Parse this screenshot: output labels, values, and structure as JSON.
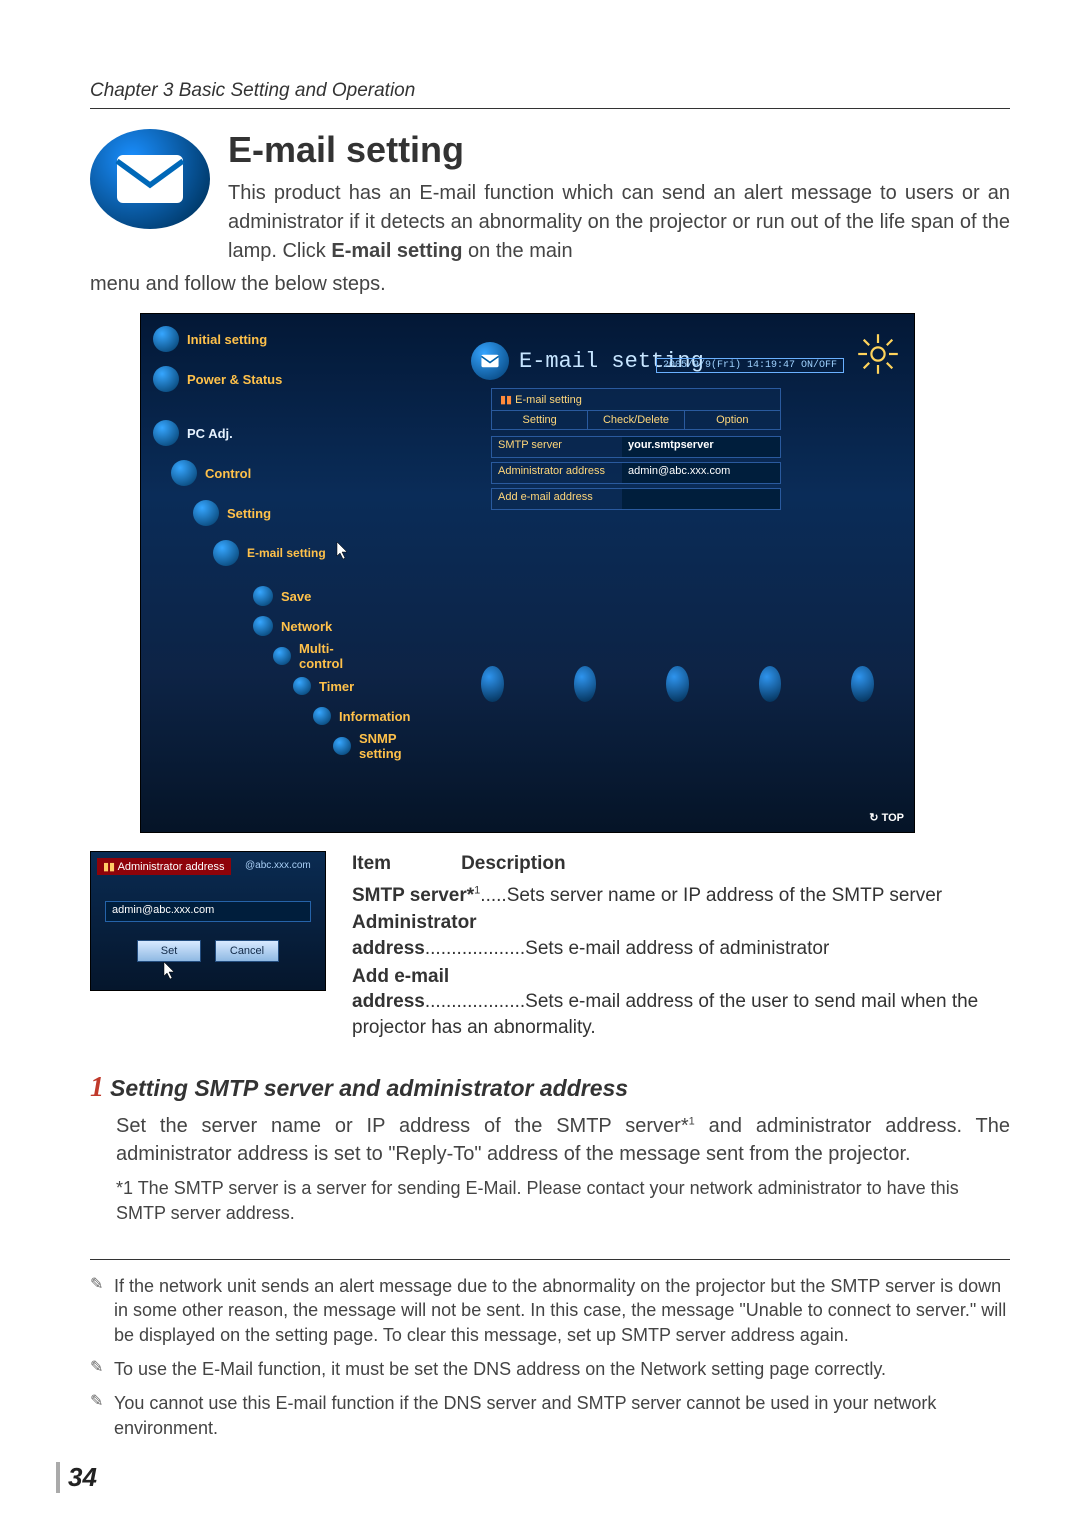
{
  "chapter": "Chapter 3 Basic Setting and Operation",
  "page_number": "34",
  "section": {
    "title": "E-mail setting",
    "intro_side": "This product has an E-mail function which can send an alert message to users or an administrator if it detects an abnormality on the projector or run out of the life span of the lamp. Click ",
    "intro_bold": "E-mail setting",
    "intro_tail": " on the main",
    "intro_cont": "menu and follow the below steps."
  },
  "screenshot": {
    "nav": {
      "initial": "Initial setting",
      "power": "Power & Status",
      "pcadj": "PC Adj.",
      "control": "Control",
      "setting": "Setting",
      "email": "E-mail setting",
      "save": "Save",
      "network": "Network",
      "multi": "Multi-control",
      "timer": "Timer",
      "info": "Information",
      "snmp": "SNMP setting"
    },
    "header": "E-mail setting",
    "datetime": "2005/9/9(Fri)  14:19:47  ON/OFF",
    "panel_caption": "E-mail setting",
    "tabs": {
      "setting": "Setting",
      "check": "Check/Delete",
      "option": "Option"
    },
    "rows": {
      "smtp_label": "SMTP server",
      "smtp_value": "your.smtpserver",
      "admin_label": "Administrator address",
      "admin_value": "admin@abc.xxx.com",
      "add_label": "Add e-mail address",
      "add_value": ""
    },
    "top": "TOP"
  },
  "mini": {
    "header": "Administrator address",
    "suffix": "@abc.xxx.com",
    "value": "admin@abc.xxx.com",
    "set": "Set",
    "cancel": "Cancel"
  },
  "desc": {
    "head_item": "Item",
    "head_desc": "Description",
    "i1_a": "SMTP server*",
    "i1_sup": "1",
    "i1_b": ".....Sets server name or IP address of the SMTP server",
    "i2_a": "Administrator",
    "i2_b": "address",
    "i2_c": "...................Sets e-mail address of administrator",
    "i3_a": "Add e-mail",
    "i3_b": "address",
    "i3_c": "...................Sets e-mail address of the user to send mail when the projector has an abnormality."
  },
  "step": {
    "num": "1",
    "title": "Setting SMTP server and administrator address",
    "body_a": "Set the server name or IP address of the SMTP server*",
    "body_sup": "1",
    "body_b": " and administrator address. The administrator address is set to \"Reply-To\" address of the message sent from the projector.",
    "fn": "*1 The SMTP server is a server for sending E-Mail. Please contact your network administrator to have this SMTP server address."
  },
  "notes": {
    "n1": "If the network unit sends an alert message due to the abnormality on the projector but the SMTP server is down in some other reason, the message will not be sent. In this case, the message \"Unable to connect to server.\" will be displayed on the setting page. To clear this message, set up SMTP server address again.",
    "n2": "To use the E-Mail function, it must be set the DNS address on the Network setting page correctly.",
    "n3": "You cannot use this E-mail function if the DNS server and SMTP server cannot be used in your network environment."
  }
}
